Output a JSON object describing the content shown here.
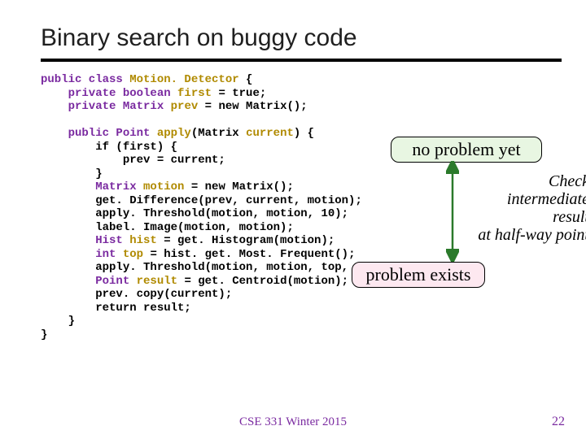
{
  "title": "Binary search on buggy code",
  "code": {
    "l1a": "public class ",
    "l1b": "Motion. Detector",
    "l1c": " {",
    "l2a": "    private boolean ",
    "l2b": "first",
    "l2c": " = true;",
    "l3a": "    private Matrix ",
    "l3b": "prev",
    "l3c": " = new Matrix();",
    "blank1": "",
    "l4a": "    public Point ",
    "l4b": "apply",
    "l4c": "(Matrix ",
    "l4d": "current",
    "l4e": ") {",
    "l5": "        if (first) {",
    "l6": "            prev = current;",
    "l7": "        }",
    "l8a": "        Matrix ",
    "l8b": "motion",
    "l8c": " = new Matrix();",
    "l9": "        get. Difference(prev, current, motion);",
    "l10": "        apply. Threshold(motion, motion, 10);",
    "l11": "        label. Image(motion, motion);",
    "l12a": "        Hist ",
    "l12b": "hist",
    "l12c": " = get. Histogram(motion);",
    "l13a": "        int ",
    "l13b": "top",
    "l13c": " = hist. get. Most. Frequent();",
    "l14": "        apply. Threshold(motion, motion, top, top);",
    "l15a": "        Point ",
    "l15b": "result",
    "l15c": " = get. Centroid(motion);",
    "l16": "        prev. copy(current);",
    "l17": "        return result;",
    "l18": "    }",
    "l19": "}"
  },
  "callouts": {
    "no_problem": "no problem yet",
    "problem": "problem exists"
  },
  "annotation": {
    "line1": "Check",
    "line2": "intermediate",
    "line3": "result",
    "line4": "at half-way point"
  },
  "footer": "CSE 331 Winter 2015",
  "page": "22"
}
